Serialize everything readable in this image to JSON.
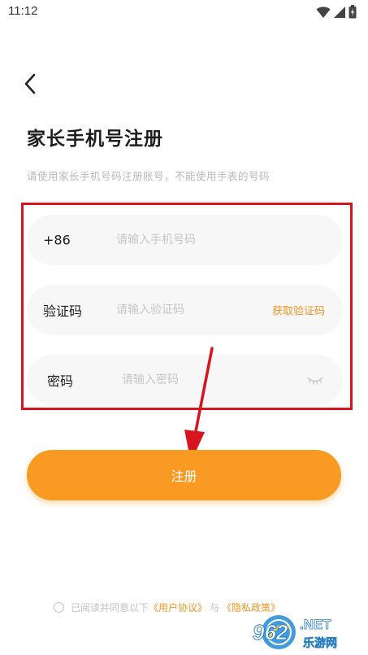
{
  "status_bar": {
    "time": "11:12"
  },
  "page": {
    "title": "家长手机号注册",
    "subtitle": "请使用家长手机号码注册账号，不能使用手表的号码"
  },
  "form": {
    "phone": {
      "prefix": "+86",
      "placeholder": "请输入手机号码",
      "value": ""
    },
    "code": {
      "label": "验证码",
      "placeholder": "请输入验证码",
      "value": "",
      "action": "获取验证码"
    },
    "password": {
      "label": "密码",
      "placeholder": "请输入密码",
      "value": ""
    }
  },
  "register_button": {
    "label": "注册"
  },
  "agreement": {
    "prefix": "已阅读并同意以下",
    "user_agreement": "《用户协议》",
    "and": "与",
    "privacy_policy": "《隐私政策》",
    "checked": false
  },
  "watermark": {
    "main": "962",
    "suffix": ".NET",
    "sub": "乐游网"
  },
  "colors": {
    "accent": "#fb9a23",
    "link": "#f29622",
    "highlight": "#d8141e"
  },
  "icons": [
    "wifi-icon",
    "signal-icon",
    "battery-icon",
    "back-arrow-icon",
    "eye-closed-icon"
  ]
}
